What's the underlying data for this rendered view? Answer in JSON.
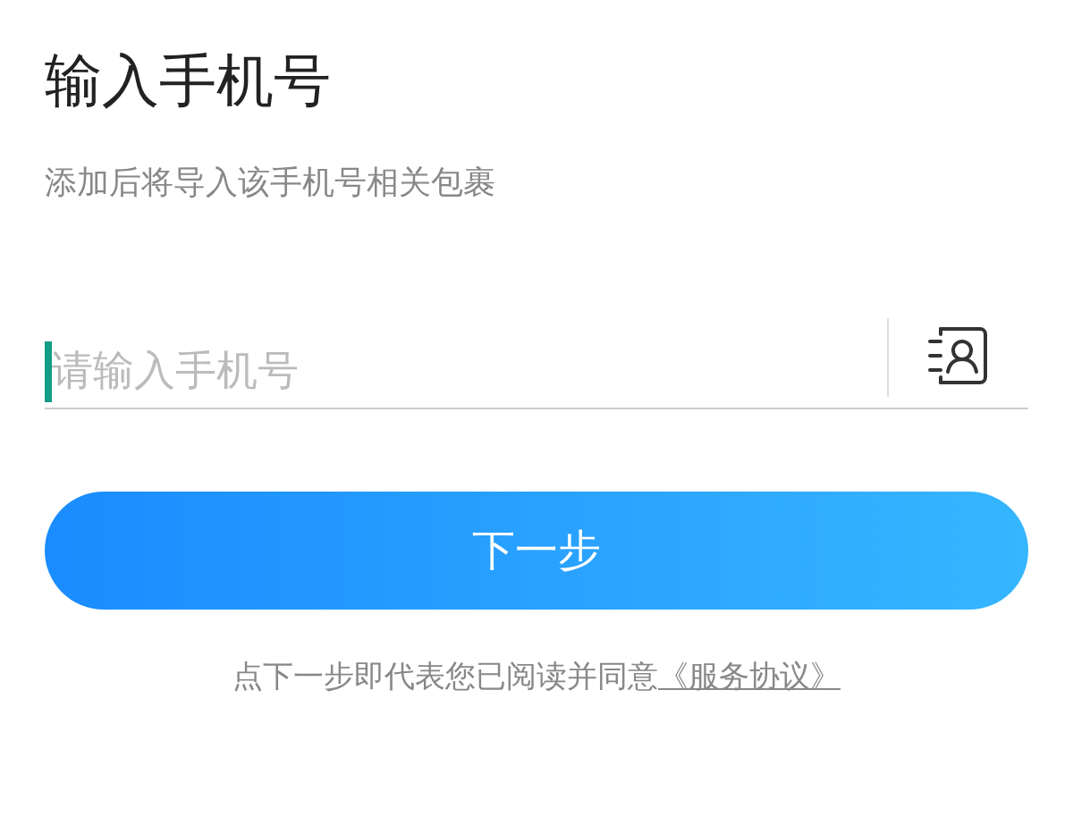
{
  "title": "输入手机号",
  "subtitle": "添加后将导入该手机号相关包裹",
  "phone_field": {
    "placeholder": "请输入手机号",
    "focused": true
  },
  "next_button": "下一步",
  "agreement": {
    "text": "点下一步即代表您已阅读并同意",
    "link": "《服务协议》"
  }
}
